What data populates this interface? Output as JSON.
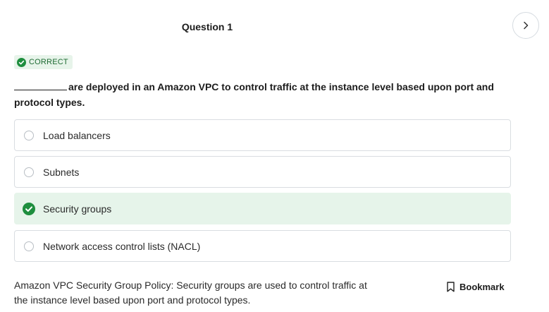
{
  "question": {
    "title": "Question 1",
    "text": "are deployed in an Amazon VPC to control traffic at the instance level based upon port and protocol types.",
    "status": "CORRECT"
  },
  "options": [
    {
      "label": "Load balancers",
      "selected": false
    },
    {
      "label": "Subnets",
      "selected": false
    },
    {
      "label": "Security groups",
      "selected": true
    },
    {
      "label": "Network access control lists (NACL)",
      "selected": false
    }
  ],
  "explanation": "Amazon VPC Security Group Policy: Security groups are used to control traffic at the instance level based upon port and protocol types.",
  "bookmark_label": "Bookmark",
  "icons": {
    "next": "chevron-right-icon",
    "status": "check-circle-icon",
    "selected": "check-circle-icon",
    "bookmark": "bookmark-icon"
  },
  "colors": {
    "correct_green": "#1e8e3e",
    "selected_bg": "#e6f4ea",
    "badge_bg": "#e7f4ea"
  }
}
